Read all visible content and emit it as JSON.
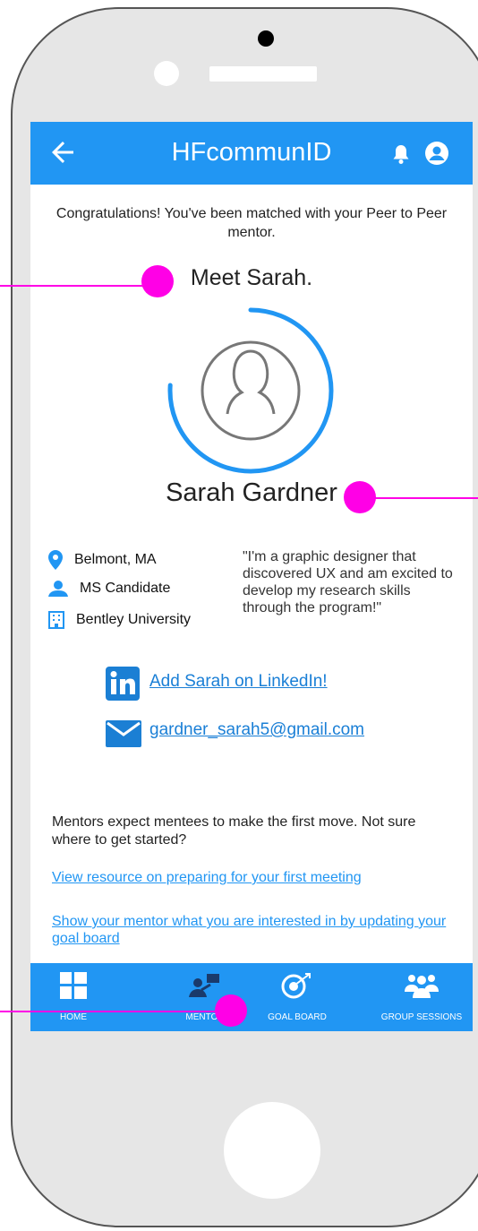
{
  "app": {
    "title": "HFcommunID",
    "brand_color": "#2196f3",
    "icons": {
      "back": "back-arrow-icon",
      "notifications": "bell-icon",
      "profile": "account-circle-icon"
    }
  },
  "match": {
    "congrats_text": "Congratulations! You've been matched with your Peer to Peer mentor.",
    "meet_text": "Meet Sarah.",
    "avatar_icon": "female-avatar-icon",
    "name": "Sarah Gardner",
    "location": "Belmont, MA",
    "degree": "MS Candidate",
    "school": "Bentley University",
    "quote": "\"I'm a graphic designer that discovered UX and am excited to develop my research skills through the program!\"",
    "linkedin_label": "Add Sarah on LinkedIn!",
    "email": "gardner_sarah5@gmail.com"
  },
  "next_steps": {
    "intro": "Mentors expect mentees to make the first move. Not sure where to get started?",
    "resource_link": "View resource on preparing for your first meeting",
    "goal_link": "Show your mentor what you are interested in by updating your goal board"
  },
  "bottom_nav": {
    "items": [
      {
        "label": "HOME",
        "icon": "home-grid-icon"
      },
      {
        "label": "MENTOR",
        "icon": "mentor-icon"
      },
      {
        "label": "GOAL BOARD",
        "icon": "target-icon"
      },
      {
        "label": "GROUP SESSIONS",
        "icon": "group-icon"
      }
    ]
  },
  "annotation_color": "#ff00e6"
}
